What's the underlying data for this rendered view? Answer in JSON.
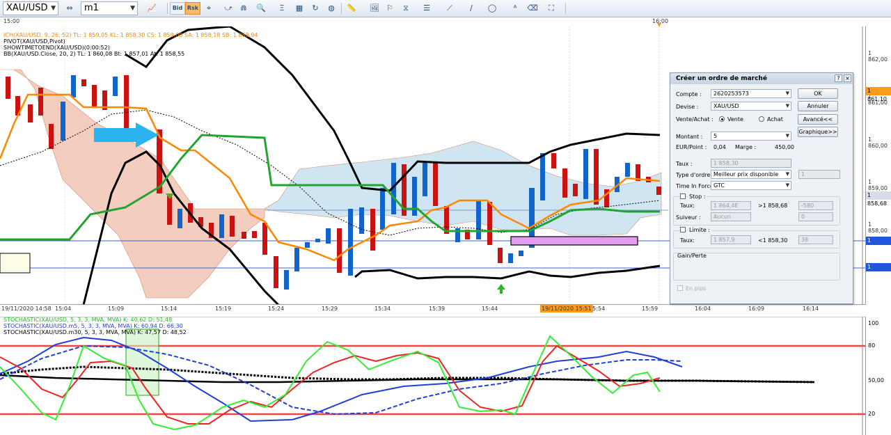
{
  "toolbar": {
    "symbol": "XAU/USD",
    "timeframe": "m1",
    "bid_label": "Bid",
    "rsk_label": "Rsk"
  },
  "top_time_labels": [
    "15:00",
    "16:00"
  ],
  "legend_main": [
    "ICH(XAU/USD, 9, 26, 52)  TL: 1 859,05  KL: 1 858,30  CS: 1 859,00  SA: 1 858,18  SB: 1 858,94",
    "PIVOT(XAU/USD,Pivot)",
    "SHOWTIMETOEND(XAU/USD)(0:00:52)",
    "BB(XAU/USD.Close, 20, 2)  TL: 1 860,08  Bt: 1 857,01  At: 1 858,55"
  ],
  "price_ticks": [
    "1 862,00",
    "1 861,00",
    "1 860,00",
    "1 859,00",
    "1 858,00"
  ],
  "price_tags": {
    "orange": "1 861,10",
    "grey": "1 858,68",
    "blue1": "1 857,62",
    "blue2": "1 856,99"
  },
  "colors": {
    "orange_tag": "#ff9a1a",
    "blue_tag": "#2255dd",
    "grey_tag": "#d7dde6"
  },
  "time_axis": {
    "left_label": "19/11/2020 14:58",
    "labels": [
      "15:04",
      "15:09",
      "15:14",
      "15:19",
      "15:24",
      "15:29",
      "15:34",
      "15:39",
      "15:44",
      "15:54",
      "15:59",
      "16:04",
      "16:09",
      "16:14"
    ],
    "cursor_label": "19/11/2020 15:51"
  },
  "legend_stoch": [
    {
      "text": "STOCHASTIC(XAU/USD, 5, 3, 3, MVA, MVA)  K: 40,62  D: 51,48",
      "color": "#22bb22"
    },
    {
      "text": "STOCHASTIC(XAU/USD.m5, 5, 3, 3, MVA, MVA)  K: 60,94  D: 66,30",
      "color": "#1f3fd8"
    },
    {
      "text": "STOCHASTIC(XAU/USD.m30, 5, 3, 3, MVA, MVA)  K: 47,57  D: 48,52",
      "color": "#000000"
    }
  ],
  "stoch_axis": [
    "100",
    "80",
    "50,00",
    "20"
  ],
  "dialog": {
    "title": "Créer un ordre de marché",
    "compte_label": "Compte :",
    "compte_value": "2620253573",
    "devise_label": "Devise :",
    "devise_value": "XAU/USD",
    "side_label": "Vente/Achat :",
    "vente_label": "Vente",
    "achat_label": "Achat",
    "montant_label": "Montant :",
    "montant_value": "5",
    "eurpoint_label": "EUR/Point :",
    "eurpoint_value": "0,04",
    "marge_label": "Marge :",
    "marge_value": "450,00",
    "taux_label": "Taux :",
    "taux_value": "1 858,30",
    "type_label": "Type d'ordre :",
    "type_value": "Meilleur prix disponible",
    "type_qty": "1",
    "tif_label": "Time In Force :",
    "tif_value": "GTC",
    "stop_label": "Stop :",
    "stop_taux_label": "Taux:",
    "stop_taux_value": "1 864,4E",
    "stop_cmp": ">1 858,68",
    "stop_pts": "-580",
    "suiveur_label": "Suiveur :",
    "suiveur_value": "Aucun",
    "suiveur_num": "0",
    "limite_label": "Limite :",
    "limite_taux_label": "Taux:",
    "limite_taux_value": "1 857,9",
    "limite_cmp": "<1 858,30",
    "limite_pts": "38",
    "gain_label": "Gain/Perte",
    "pips_label": "En pips",
    "ok_label": "OK",
    "annuler_label": "Annuler",
    "avance_label": "Avancé<<",
    "graphique_label": "Graphique>>",
    "help_label": "?",
    "close_label": "×"
  }
}
